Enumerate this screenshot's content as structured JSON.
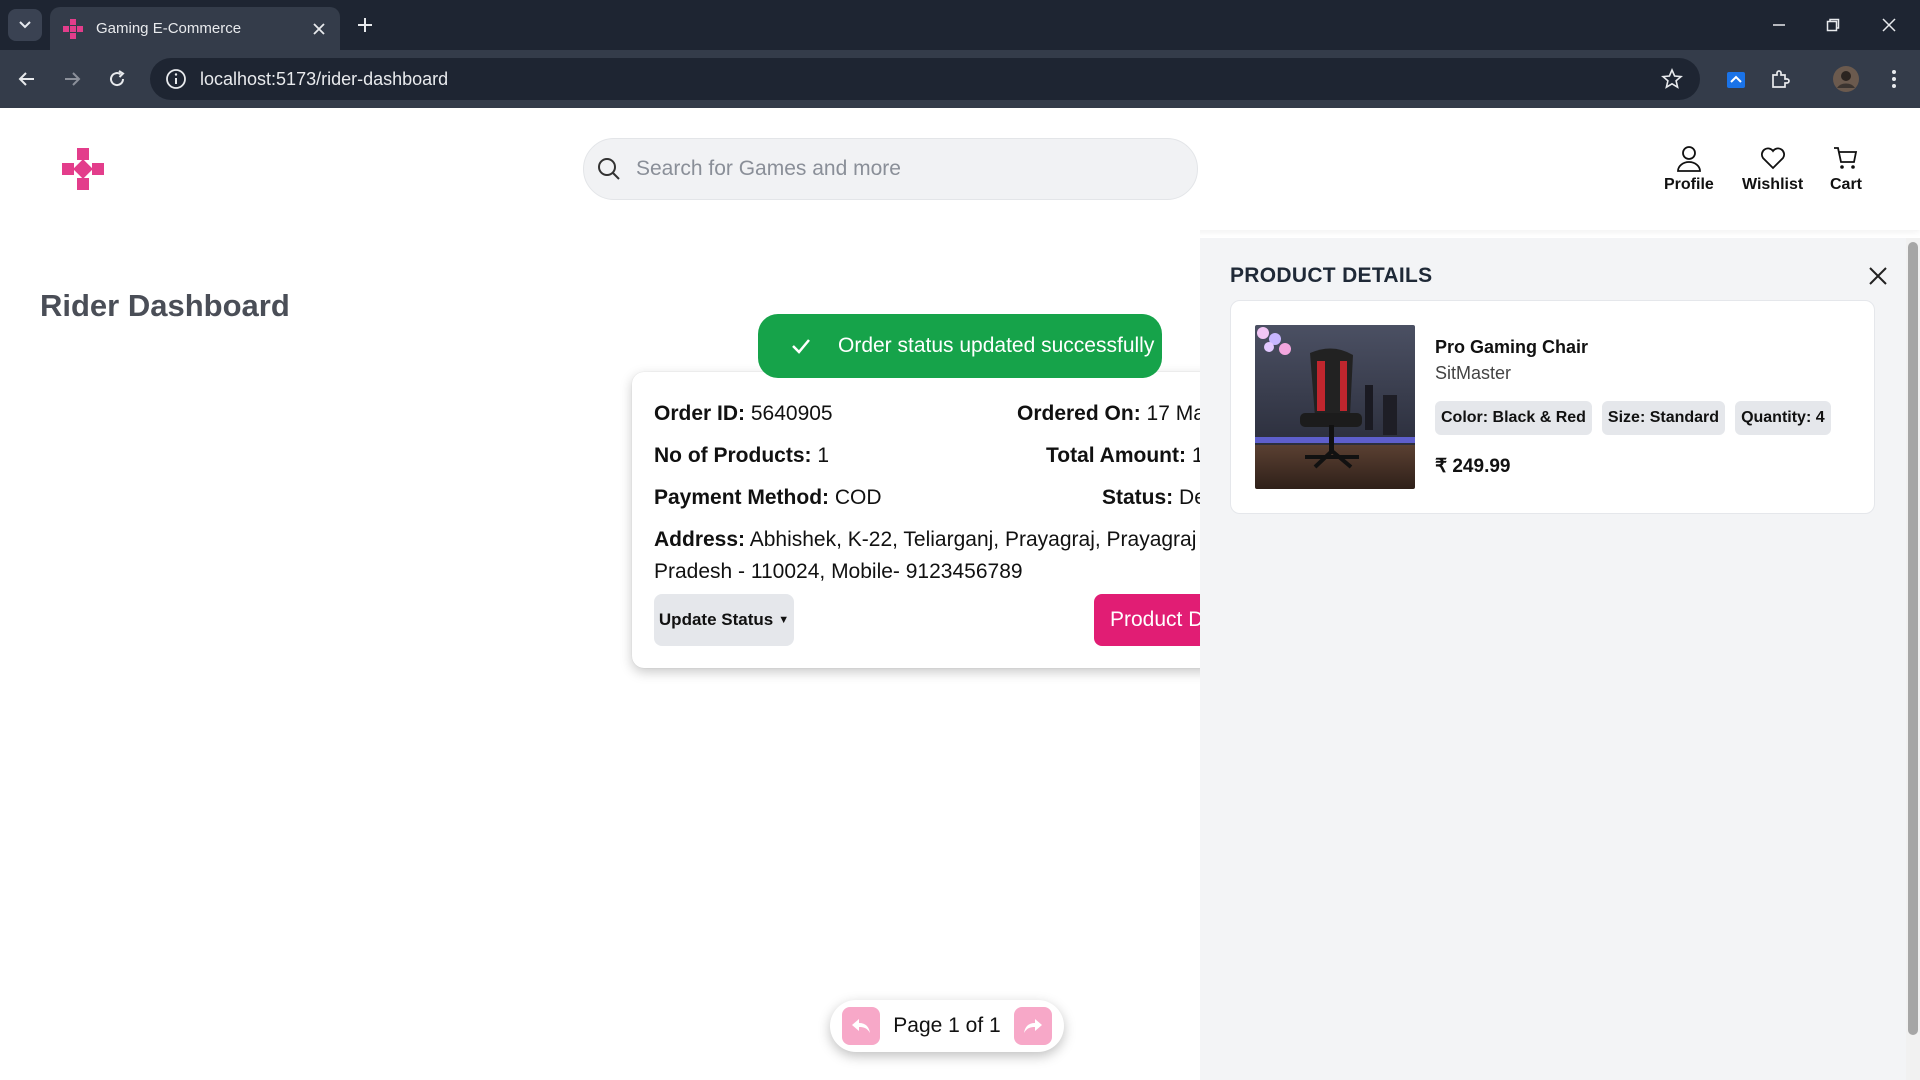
{
  "browser": {
    "tab_title": "Gaming E-Commerce",
    "url": "localhost:5173/rider-dashboard"
  },
  "header": {
    "search_placeholder": "Search for Games and more",
    "nav": {
      "profile": "Profile",
      "wishlist": "Wishlist",
      "cart": "Cart"
    },
    "brand_color": "#e33d8b"
  },
  "main": {
    "title": "Rider Dashboard",
    "toast": "Order status updated successfully",
    "order": {
      "order_id_label": "Order ID:",
      "order_id": "5640905",
      "ordered_on_label": "Ordered On:",
      "ordered_on": "17 Ma",
      "num_products_label": "No of Products:",
      "num_products": "1",
      "total_label": "Total Amount:",
      "total": "1",
      "payment_label": "Payment Method:",
      "payment": "COD",
      "status_label": "Status:",
      "status": "De",
      "address_label": "Address:",
      "address": "Abhishek, K-22, Teliarganj, Prayagraj, Prayagraj Pradesh - 110024, Mobile- 9123456789",
      "update_status_label": "Update Status",
      "product_details_label": "Product D"
    },
    "pagination": {
      "text": "Page 1 of 1"
    }
  },
  "drawer": {
    "title": "PRODUCT DETAILS",
    "product": {
      "name": "Pro Gaming Chair",
      "brand": "SitMaster",
      "color_chip": "Color: Black & Red",
      "size_chip": "Size: Standard",
      "qty_chip": "Quantity: 4",
      "price": "₹ 249.99"
    }
  },
  "colors": {
    "toast_green": "#16a34a",
    "accent_pink": "#e11d74",
    "arrow_pink": "#f7a8c8"
  }
}
